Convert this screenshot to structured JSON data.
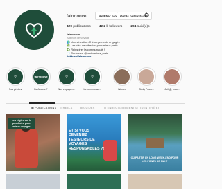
{
  "profile": {
    "username": "fairmoove",
    "buttons": [
      "Modifier profil",
      "Outils publicitaires"
    ],
    "stats": [
      {
        "value": "429",
        "label": "publications"
      },
      {
        "value": "42,2 k",
        "label": "followers"
      },
      {
        "value": "204",
        "label": "suivi(e)s"
      }
    ],
    "bio": {
      "name": "fairmoove",
      "category": "Agence de voyage",
      "lines": [
        "🌍 Une sélection d'hébergements engagés",
        "🌿 Les clés de réflexion pour mieux partir",
        "♻️ Réinspirer la communauté !",
        "✉️ Contactez @partenaires_mate"
      ],
      "link": "linktr.ee/fairmoove"
    }
  },
  "highlights": [
    {
      "label": "Nos pépites",
      "badge": ""
    },
    {
      "label": "FairMoove ?",
      "badge": "fairmoove"
    },
    {
      "label": "Nos engagem...",
      "badge": ""
    },
    {
      "label": "La communau...",
      "badge": ""
    },
    {
      "label": "Wanted",
      "badge": ""
    },
    {
      "label": "Cindy Pourc...",
      "badge": ""
    },
    {
      "label": "Juil 🏝 mas...",
      "badge": ""
    }
  ],
  "tabs": [
    "PUBLICATIONS",
    "REELS",
    "GUIDES",
    "ENREGISTREMENTS",
    "IDENTIFIÉ(E)"
  ],
  "posts": [
    {
      "caption": "Les règles sur le pourboire pour mieux voyager"
    },
    {
      "caption": "ET SI VOUS DEVENIEZ TESTEURS DE VOYAGES RESPONSABLES ?!"
    },
    {
      "caption": "OÙ PARTIR EN LONG WEEK-END POUR LES PONTS DE MAI ?"
    }
  ],
  "colors": {
    "brand": "#1f4d3a",
    "accent": "#3fbf7f",
    "link": "#00376b"
  }
}
